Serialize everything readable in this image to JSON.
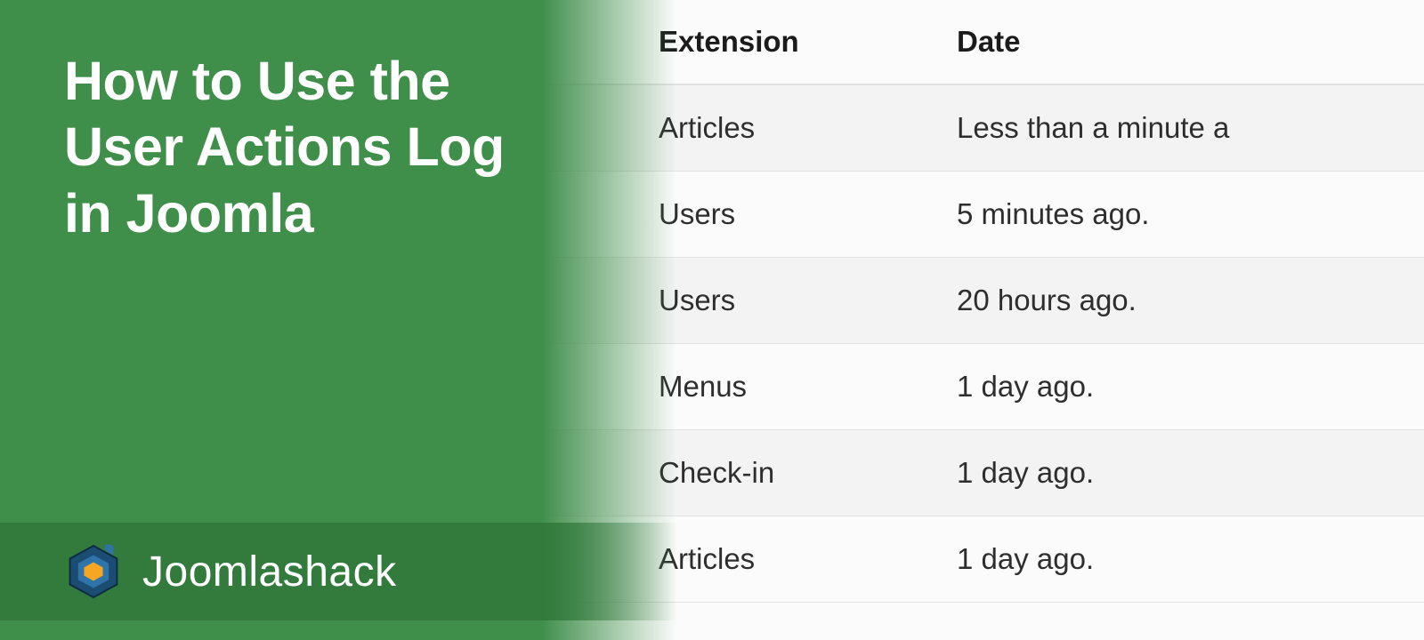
{
  "title": "How to Use the User Actions Log in Joomla",
  "brand": "Joomlashack",
  "table": {
    "headers": {
      "extension": "Extension",
      "date": "Date"
    },
    "rows": [
      {
        "extension": "Articles",
        "date": "Less than a minute a"
      },
      {
        "extension": "Users",
        "date": "5 minutes ago."
      },
      {
        "extension": "Users",
        "date": "20 hours ago."
      },
      {
        "extension": "Menus",
        "date": "1 day ago."
      },
      {
        "extension": "Check-in",
        "date": "1 day ago."
      },
      {
        "extension": "Articles",
        "date": "1 day ago."
      }
    ]
  }
}
